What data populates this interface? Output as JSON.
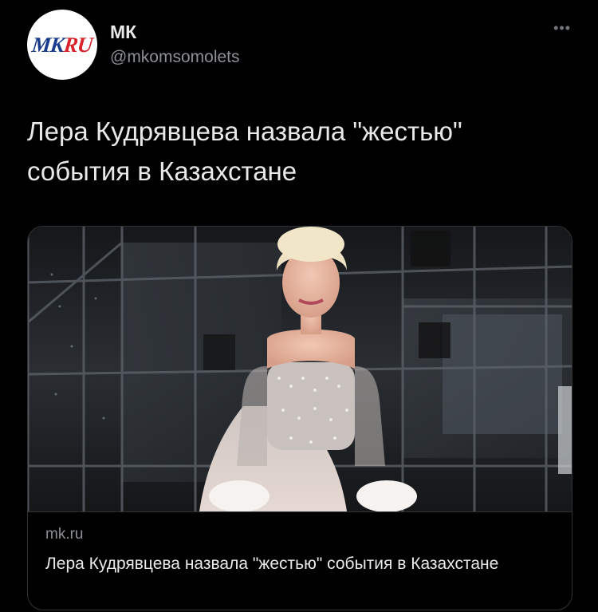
{
  "author": {
    "name": "МК",
    "handle": "@mkomsomolets",
    "avatar_logo_main": "MK",
    "avatar_logo_accent": "RU"
  },
  "more_menu": "•••",
  "tweet": {
    "text": "Лера Кудрявцева назвала \"жестью\" события в Казахстане"
  },
  "link_card": {
    "domain": "mk.ru",
    "title": "Лера Кудрявцева назвала \"жестью\" события в Казахстане",
    "image_subject": "photo-woman-in-sparkly-gown-on-stage"
  },
  "colors": {
    "background": "#000000",
    "text_primary": "#e7e9ea",
    "text_secondary": "#8b9096",
    "card_border": "#2f3336",
    "logo_blue": "#1a3c8c",
    "logo_red": "#d8232a"
  }
}
